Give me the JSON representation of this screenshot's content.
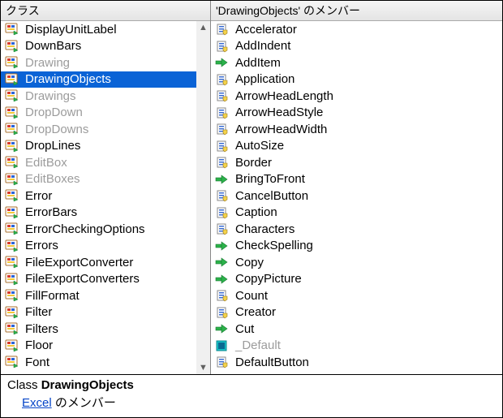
{
  "left": {
    "header": "クラス",
    "items": [
      {
        "label": "DisplayUnitLabel",
        "type": "class"
      },
      {
        "label": "DownBars",
        "type": "class"
      },
      {
        "label": "Drawing",
        "type": "class",
        "dimmed": true
      },
      {
        "label": "DrawingObjects",
        "type": "class",
        "selected": true
      },
      {
        "label": "Drawings",
        "type": "class",
        "dimmed": true
      },
      {
        "label": "DropDown",
        "type": "class",
        "dimmed": true
      },
      {
        "label": "DropDowns",
        "type": "class",
        "dimmed": true
      },
      {
        "label": "DropLines",
        "type": "class"
      },
      {
        "label": "EditBox",
        "type": "class",
        "dimmed": true
      },
      {
        "label": "EditBoxes",
        "type": "class",
        "dimmed": true
      },
      {
        "label": "Error",
        "type": "class"
      },
      {
        "label": "ErrorBars",
        "type": "class"
      },
      {
        "label": "ErrorCheckingOptions",
        "type": "class"
      },
      {
        "label": "Errors",
        "type": "class"
      },
      {
        "label": "FileExportConverter",
        "type": "class"
      },
      {
        "label": "FileExportConverters",
        "type": "class"
      },
      {
        "label": "FillFormat",
        "type": "class"
      },
      {
        "label": "Filter",
        "type": "class"
      },
      {
        "label": "Filters",
        "type": "class"
      },
      {
        "label": "Floor",
        "type": "class"
      },
      {
        "label": "Font",
        "type": "class"
      }
    ]
  },
  "right": {
    "header": "'DrawingObjects' のメンバー",
    "items": [
      {
        "label": "Accelerator",
        "type": "property"
      },
      {
        "label": "AddIndent",
        "type": "property"
      },
      {
        "label": "AddItem",
        "type": "method"
      },
      {
        "label": "Application",
        "type": "property"
      },
      {
        "label": "ArrowHeadLength",
        "type": "property"
      },
      {
        "label": "ArrowHeadStyle",
        "type": "property"
      },
      {
        "label": "ArrowHeadWidth",
        "type": "property"
      },
      {
        "label": "AutoSize",
        "type": "property"
      },
      {
        "label": "Border",
        "type": "property"
      },
      {
        "label": "BringToFront",
        "type": "method"
      },
      {
        "label": "CancelButton",
        "type": "property"
      },
      {
        "label": "Caption",
        "type": "property"
      },
      {
        "label": "Characters",
        "type": "property"
      },
      {
        "label": "CheckSpelling",
        "type": "method"
      },
      {
        "label": "Copy",
        "type": "method"
      },
      {
        "label": "CopyPicture",
        "type": "method"
      },
      {
        "label": "Count",
        "type": "property"
      },
      {
        "label": "Creator",
        "type": "property"
      },
      {
        "label": "Cut",
        "type": "method"
      },
      {
        "label": "_Default",
        "type": "default",
        "dimmed": true
      },
      {
        "label": "DefaultButton",
        "type": "property"
      }
    ]
  },
  "bottom": {
    "class_label": "Class ",
    "class_name": "DrawingObjects",
    "link": "Excel",
    "member_suffix": " のメンバー"
  },
  "icons": {
    "class": "class-icon",
    "property": "property-icon",
    "method": "method-icon",
    "default": "default-icon"
  },
  "colors": {
    "selection": "#0a63d6",
    "link": "#0645c8",
    "dimmed": "#9c9c9c"
  }
}
